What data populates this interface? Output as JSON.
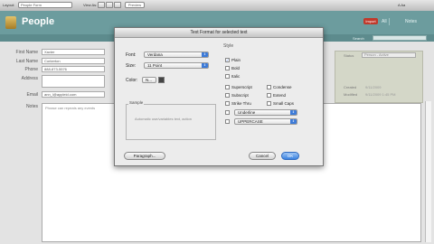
{
  "toolbar": {
    "layout_label": "Layout:",
    "layout_value": "People Form",
    "view_as_label": "View As:",
    "preview_label": "Preview",
    "right_label": "A  Aa"
  },
  "header": {
    "title": "People",
    "badge": "Import",
    "link_all": "All",
    "link_notes": "Notes"
  },
  "subbar": {
    "search_label": "Search"
  },
  "form": {
    "first_name_label": "First Name",
    "first_name_value": "Xavier",
    "last_name_label": "Last Name",
    "last_name_value": "Corkerton",
    "phone_label": "Phone",
    "phone_value": "888-873-5576",
    "address_label": "Address",
    "email_label": "Email",
    "email_value": "ann_l@appleid.com",
    "notes_label": "Notes",
    "notes_value": "Phrase can repeats any events"
  },
  "right_panel": {
    "status_label": "Status",
    "status_value": "Person - Active",
    "created_label": "Created",
    "created_value": "9/11/2009",
    "modified_label": "Modified",
    "modified_value": "9/11/2009 1:45 PM"
  },
  "dialog": {
    "title": "Text Format for selected text",
    "font_label": "Font:",
    "font_value": "Verdana",
    "size_label": "Size:",
    "size_value": "11 Point",
    "color_label": "Color:",
    "color_value": "N...",
    "color_swatch": "#444444",
    "style_header": "Style",
    "styles": [
      {
        "label": "Plain",
        "checked": true
      },
      {
        "label": "Bold",
        "checked": false
      },
      {
        "label": "Italic",
        "checked": false
      },
      {
        "label": "Superscript",
        "checked": false
      },
      {
        "label": "Subscript",
        "checked": false
      },
      {
        "label": "Strike Thru",
        "checked": false
      },
      {
        "label": "Condense",
        "checked": false
      },
      {
        "label": "Extend",
        "checked": false
      },
      {
        "label": "Small Caps",
        "checked": false
      }
    ],
    "underline_value": "Underline",
    "case_value": "UPPERCASE",
    "sample_title": "Sample",
    "sample_text": "Automatic use/variables text, action",
    "paragraph_button": "Paragraph...",
    "cancel_button": "Cancel",
    "ok_button": "OK",
    "accent": "#3a82e0"
  }
}
